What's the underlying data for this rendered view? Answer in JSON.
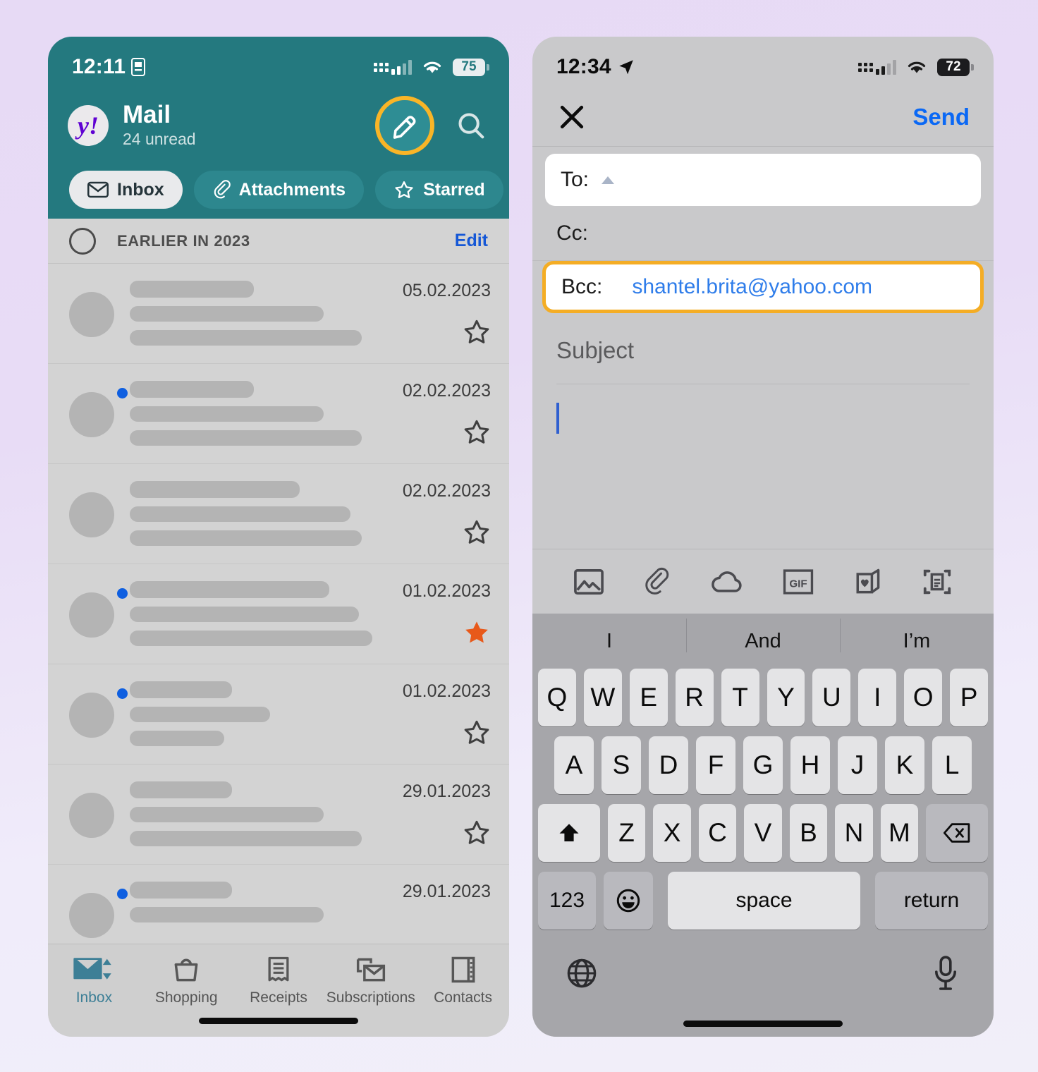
{
  "background": {
    "top_color": "#e7daf5",
    "bottom_color": "#f1eff9"
  },
  "left_phone": {
    "status_bar": {
      "time": "12:11",
      "time_icon": "sim-card-icon",
      "battery": "75",
      "wifi": "wifi-icon",
      "signal": "cellular-signal-icon"
    },
    "header": {
      "brand_logo": "yahoo-logo",
      "logo_text": "y!",
      "title": "Mail",
      "subtitle": "24 unread",
      "compose_icon": "compose-pencil-icon",
      "search_icon": "search-icon",
      "accent_highlight": "#f4ad25",
      "bg_color": "#24797f"
    },
    "filter_pills": [
      {
        "label": "Inbox",
        "icon": "envelope-icon",
        "active": true
      },
      {
        "label": "Attachments",
        "icon": "paperclip-icon",
        "active": false
      },
      {
        "label": "Starred",
        "icon": "star-outline-icon",
        "active": false
      },
      {
        "label": "",
        "icon": "circle-icon",
        "active": false,
        "partial": true
      }
    ],
    "list_header": {
      "select_icon": "select-circle-icon",
      "title": "EARLIER IN 2023",
      "edit_label": "Edit"
    },
    "messages": [
      {
        "date": "05.02.2023",
        "unread": false,
        "starred": false,
        "line_widths": [
          46,
          72,
          86
        ]
      },
      {
        "date": "02.02.2023",
        "unread": true,
        "starred": false,
        "line_widths": [
          46,
          72,
          86
        ]
      },
      {
        "date": "02.02.2023",
        "unread": false,
        "starred": false,
        "line_widths": [
          63,
          82,
          86
        ]
      },
      {
        "date": "01.02.2023",
        "unread": true,
        "starred": true,
        "line_widths": [
          74,
          85,
          90
        ]
      },
      {
        "date": "01.02.2023",
        "unread": true,
        "starred": false,
        "line_widths": [
          38,
          52,
          35
        ]
      },
      {
        "date": "29.01.2023",
        "unread": false,
        "starred": false,
        "line_widths": [
          38,
          72,
          86
        ]
      },
      {
        "date": "29.01.2023",
        "unread": true,
        "starred": false,
        "line_widths": [
          38,
          72,
          0
        ]
      }
    ],
    "tab_bar": [
      {
        "label": "Inbox",
        "icon": "inbox-envelope-icon",
        "active": true
      },
      {
        "label": "Shopping",
        "icon": "shopping-bag-icon",
        "active": false
      },
      {
        "label": "Receipts",
        "icon": "receipt-icon",
        "active": false
      },
      {
        "label": "Subscriptions",
        "icon": "subscriptions-icon",
        "active": false
      },
      {
        "label": "Contacts",
        "icon": "contacts-card-icon",
        "active": false
      }
    ]
  },
  "right_phone": {
    "status_bar": {
      "time": "12:34",
      "time_icon": "location-arrow-icon",
      "battery": "72",
      "wifi": "wifi-icon",
      "signal": "cellular-signal-icon"
    },
    "nav": {
      "close_icon": "close-x-icon",
      "send_label": "Send",
      "send_color": "#0a68f5"
    },
    "fields": {
      "to": {
        "label": "To:",
        "value": "",
        "expand_icon": "triangle-up-icon",
        "focused": true
      },
      "cc": {
        "label": "Cc:",
        "value": ""
      },
      "bcc": {
        "label": "Bcc:",
        "value": "shantel.brita@yahoo.com",
        "highlighted": true,
        "highlight_color": "#f4ad25"
      }
    },
    "subject": {
      "placeholder": "Subject",
      "value": ""
    },
    "body": {
      "value": "",
      "caret_color": "#2f5fd0"
    },
    "attachment_toolbar": [
      {
        "icon": "photo-image-icon"
      },
      {
        "icon": "paperclip-icon"
      },
      {
        "icon": "cloud-icon"
      },
      {
        "icon": "gif-icon",
        "label": "GIF"
      },
      {
        "icon": "greeting-card-heart-icon"
      },
      {
        "icon": "scan-document-icon"
      }
    ],
    "keyboard": {
      "predictions": [
        "I",
        "And",
        "I’m"
      ],
      "row1": [
        "Q",
        "W",
        "E",
        "R",
        "T",
        "Y",
        "U",
        "I",
        "O",
        "P"
      ],
      "row2": [
        "A",
        "S",
        "D",
        "F",
        "G",
        "H",
        "J",
        "K",
        "L"
      ],
      "row3": [
        "Z",
        "X",
        "C",
        "V",
        "B",
        "N",
        "M"
      ],
      "shift_icon": "shift-arrow-icon",
      "delete_icon": "backspace-icon",
      "numbers_label": "123",
      "emoji_icon": "emoji-smiley-icon",
      "space_label": "space",
      "return_label": "return",
      "globe_icon": "globe-icon",
      "mic_icon": "microphone-icon"
    }
  }
}
